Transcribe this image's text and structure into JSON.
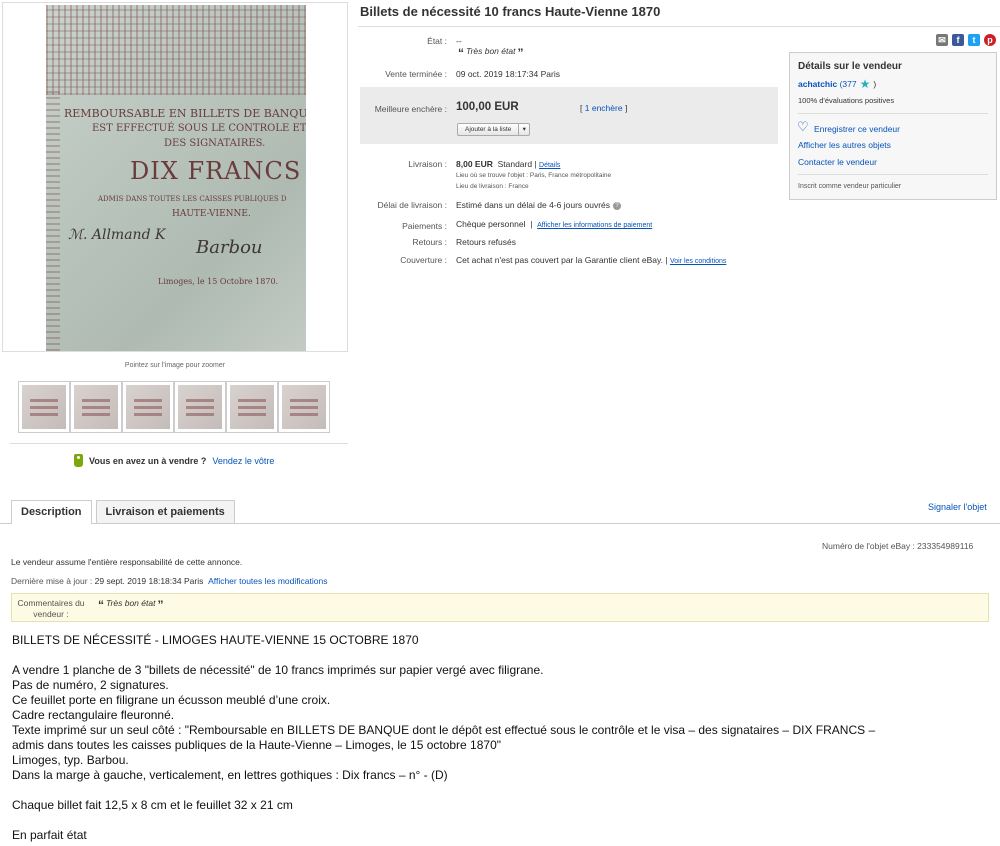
{
  "listing": {
    "title": "Billets de nécessité 10 francs Haute-Vienne 1870",
    "zoom_hint": "Pointez sur l'image pour zoomer",
    "photo_text": {
      "line1": "REMBOURSABLE EN BILLETS DE BANQUE, D",
      "line2": "EST EFFECTUÉ SOUS LE CONTROLE ET L",
      "line3": "DES SIGNATAIRES.",
      "line4": "DIX FRANCS",
      "line5": "ADMIS DANS TOUTES LES CAISSES PUBLIQUES D",
      "line6": "HAUTE-VIENNE.",
      "line7": "Limoges, le 15 Octobre 1870."
    },
    "thumbnails": [
      "thumb-1",
      "thumb-2",
      "thumb-3",
      "thumb-4",
      "thumb-5",
      "thumb-6"
    ],
    "sell": {
      "question": "Vous en avez un à vendre ?",
      "link": "Vendez le vôtre"
    }
  },
  "share": {
    "email_icon": "email-icon",
    "facebook_icon": "facebook-icon",
    "twitter_icon": "twitter-icon",
    "pinterest_icon": "pinterest-icon",
    "facebook_glyph": "f",
    "twitter_glyph": "t",
    "pinterest_glyph": "p"
  },
  "details": {
    "condition_label": "État :",
    "condition_value": "--",
    "condition_quote": "Très bon état",
    "ended_label": "Vente terminée :",
    "ended_value": "09 oct. 2019  18:17:34 Paris",
    "best_bid_label": "Meilleure enchère :",
    "best_bid_value": "100,00 EUR",
    "bid_count_open": "[",
    "bid_count_link": "1 enchère",
    "bid_count_close": "]",
    "watch_label": "Ajouter à la liste",
    "watch_caret": "▾",
    "shipping_label": "Livraison :",
    "shipping_price": "8,00 EUR",
    "shipping_service": "Standard",
    "shipping_details_link": "Détails",
    "item_location": "Lieu où se trouve l'objet :  Paris, France métropolitaine",
    "ship_to": "Lieu de livraison :  France",
    "delivery_label": "Délai de livraison :",
    "delivery_value": "Estimé dans un délai de 4-6 jours ouvrés",
    "payment_label": "Paiements :",
    "payment_value": "Chèque personnel",
    "payment_link": "Afficher les informations de paiement",
    "returns_label": "Retours :",
    "returns_value": "Retours refusés",
    "coverage_label": "Couverture :",
    "coverage_value": "Cet achat n'est pas couvert par la Garantie client eBay.",
    "coverage_link": "Voir les conditions"
  },
  "seller": {
    "heading": "Détails sur le vendeur",
    "name": "achatchic",
    "feedback_open": "(377",
    "feedback_close": ")",
    "positive": "100% d'évaluations positives",
    "save_seller": "Enregistrer ce vendeur",
    "other_items": "Afficher les autres objets",
    "contact": "Contacter le vendeur",
    "type": "Inscrit comme vendeur particulier"
  },
  "tabs": {
    "description": "Description",
    "shipping": "Livraison et paiements",
    "report": "Signaler l'objet"
  },
  "item_meta": {
    "item_number": "Numéro de l'objet eBay :  233354989116",
    "responsibility": "Le vendeur assume l'entière responsabilité de cette annonce.",
    "last_update_label": "Dernière mise à jour :",
    "last_update_value": "29 sept. 2019 18:18:34 Paris",
    "show_changes": "Afficher toutes les modifications",
    "comments_label": "Commentaires du vendeur :",
    "comments_value": "Très bon état"
  },
  "description": {
    "heading": "BILLETS DE NÉCESSITÉ - LIMOGES HAUTE-VIENNE 15 OCTOBRE 1870",
    "lines": [
      "A vendre 1 planche de 3 \"billets de nécessité\" de 10 francs imprimés sur papier vergé avec filigrane.",
      "Pas de numéro, 2 signatures.",
      "Ce feuillet porte en filigrane un écusson meublé d’une croix.",
      "Cadre rectangulaire fleuronné.",
      "Texte imprimé sur un seul côté : \"Remboursable en BILLETS DE BANQUE dont le dépôt est effectué sous le contrôle et le visa – des signataires – DIX FRANCS –",
      "admis dans toutes les caisses publiques de la Haute-Vienne – Limoges, le 15 octobre 1870\"",
      "Limoges, typ. Barbou.",
      "Dans la marge à gauche, verticalement, en lettres gothiques : Dix francs – n° - (D)"
    ],
    "size": "Chaque billet fait 12,5 x 8 cm et le feuillet 32 x 21 cm",
    "condition": "En parfait état"
  }
}
